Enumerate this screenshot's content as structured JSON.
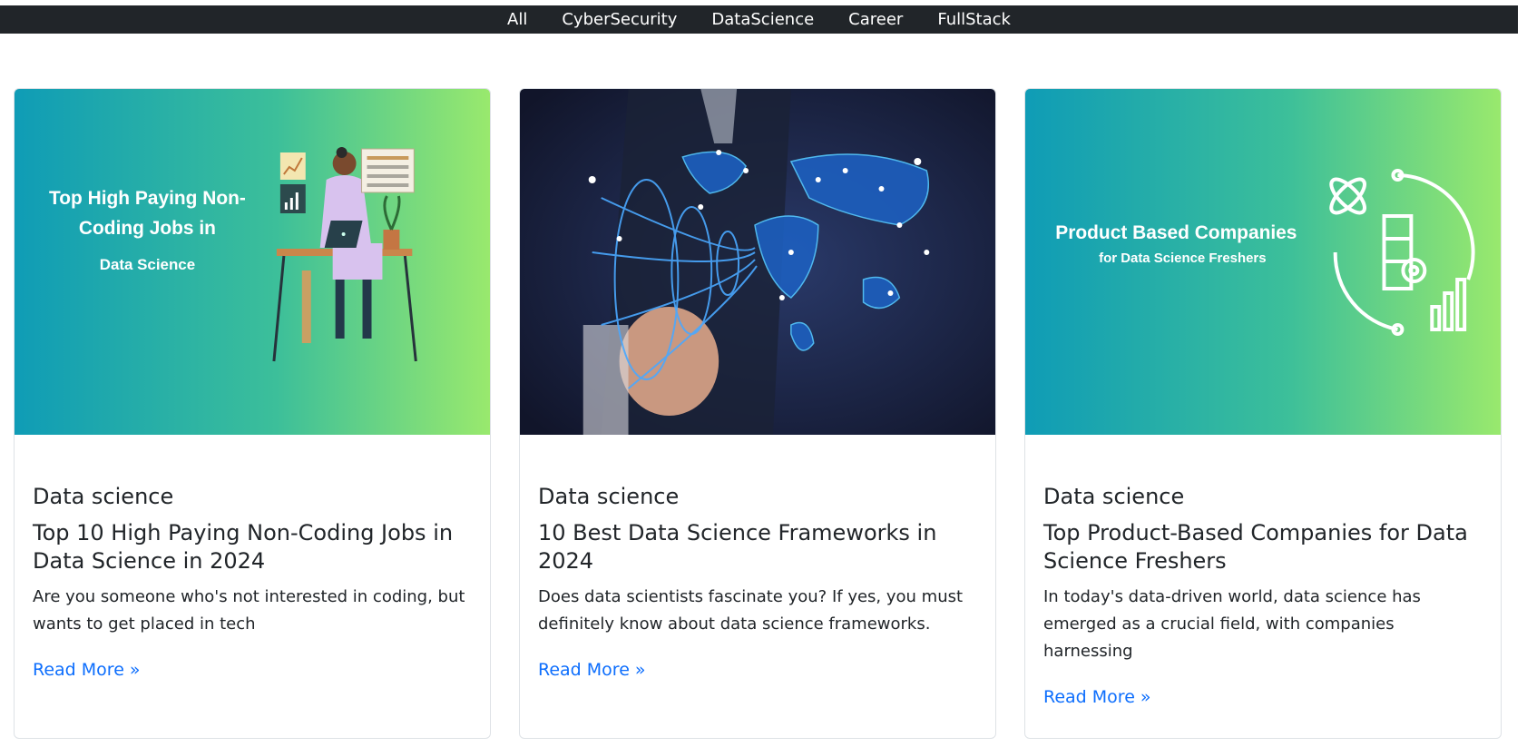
{
  "nav": {
    "items": [
      {
        "label": "All"
      },
      {
        "label": "CyberSecurity"
      },
      {
        "label": "DataScience"
      },
      {
        "label": "Career"
      },
      {
        "label": "FullStack"
      }
    ]
  },
  "cards": [
    {
      "image_text": {
        "line1": "Top High Paying Non-",
        "line2": "Coding Jobs in",
        "line3": "Data Science"
      },
      "category": "Data science",
      "title": "Top 10 High Paying Non-Coding Jobs in Data Science in 2024",
      "text": "Are you someone who's not interested in coding, but wants to get placed in tech",
      "link": "Read More »"
    },
    {
      "image_text": {},
      "category": "Data science",
      "title": "10 Best Data Science Frameworks in 2024",
      "text": "Does data scientists fascinate you? If yes, you must definitely know about data science frameworks.",
      "link": "Read More »"
    },
    {
      "image_text": {
        "line1": "Product Based Companies",
        "line2": "for Data Science Freshers"
      },
      "category": "Data science",
      "title": "Top Product-Based Companies for Data Science Freshers",
      "text": "In today's data-driven world, data science has emerged as a crucial field, with companies harnessing",
      "link": "Read More »"
    }
  ],
  "colors": {
    "nav_bg": "#212529",
    "link": "#0d6efd",
    "gradient_start": "#0f9cb6",
    "gradient_end": "#99e96d",
    "globe_bg": "#1b2240"
  }
}
